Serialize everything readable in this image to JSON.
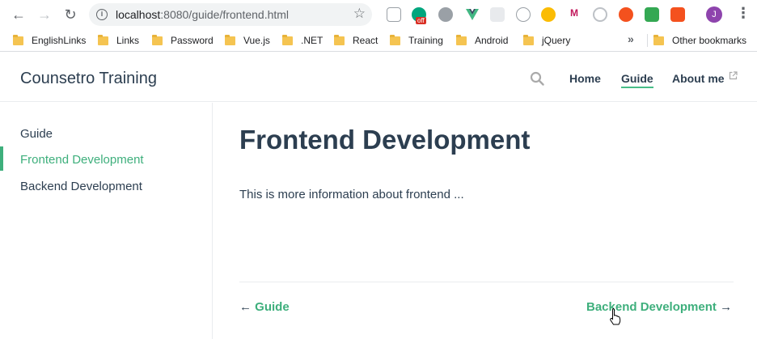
{
  "browser": {
    "url_host": "localhost",
    "url_rest": ":8080/guide/frontend.html",
    "profile_initial": "J",
    "extension_badge": "off",
    "bookmarks": [
      "EnglishLinks",
      "Links",
      "Password",
      "Vue.js",
      ".NET",
      "React",
      "Training",
      "Android",
      "jQuery"
    ],
    "bookmarks_more": "»",
    "other_bookmarks": "Other bookmarks"
  },
  "site": {
    "title": "Counsetro Training",
    "nav": [
      "Home",
      "Guide",
      "About me"
    ],
    "accent_color": "#3eaf7c"
  },
  "sidebar": {
    "items": [
      "Guide",
      "Frontend Development",
      "Backend Development"
    ]
  },
  "page": {
    "title": "Frontend Development",
    "text": "This is more information about frontend ...",
    "prev_arrow": "←",
    "prev_label": "Guide",
    "next_label": "Backend Development",
    "next_arrow": "→"
  }
}
